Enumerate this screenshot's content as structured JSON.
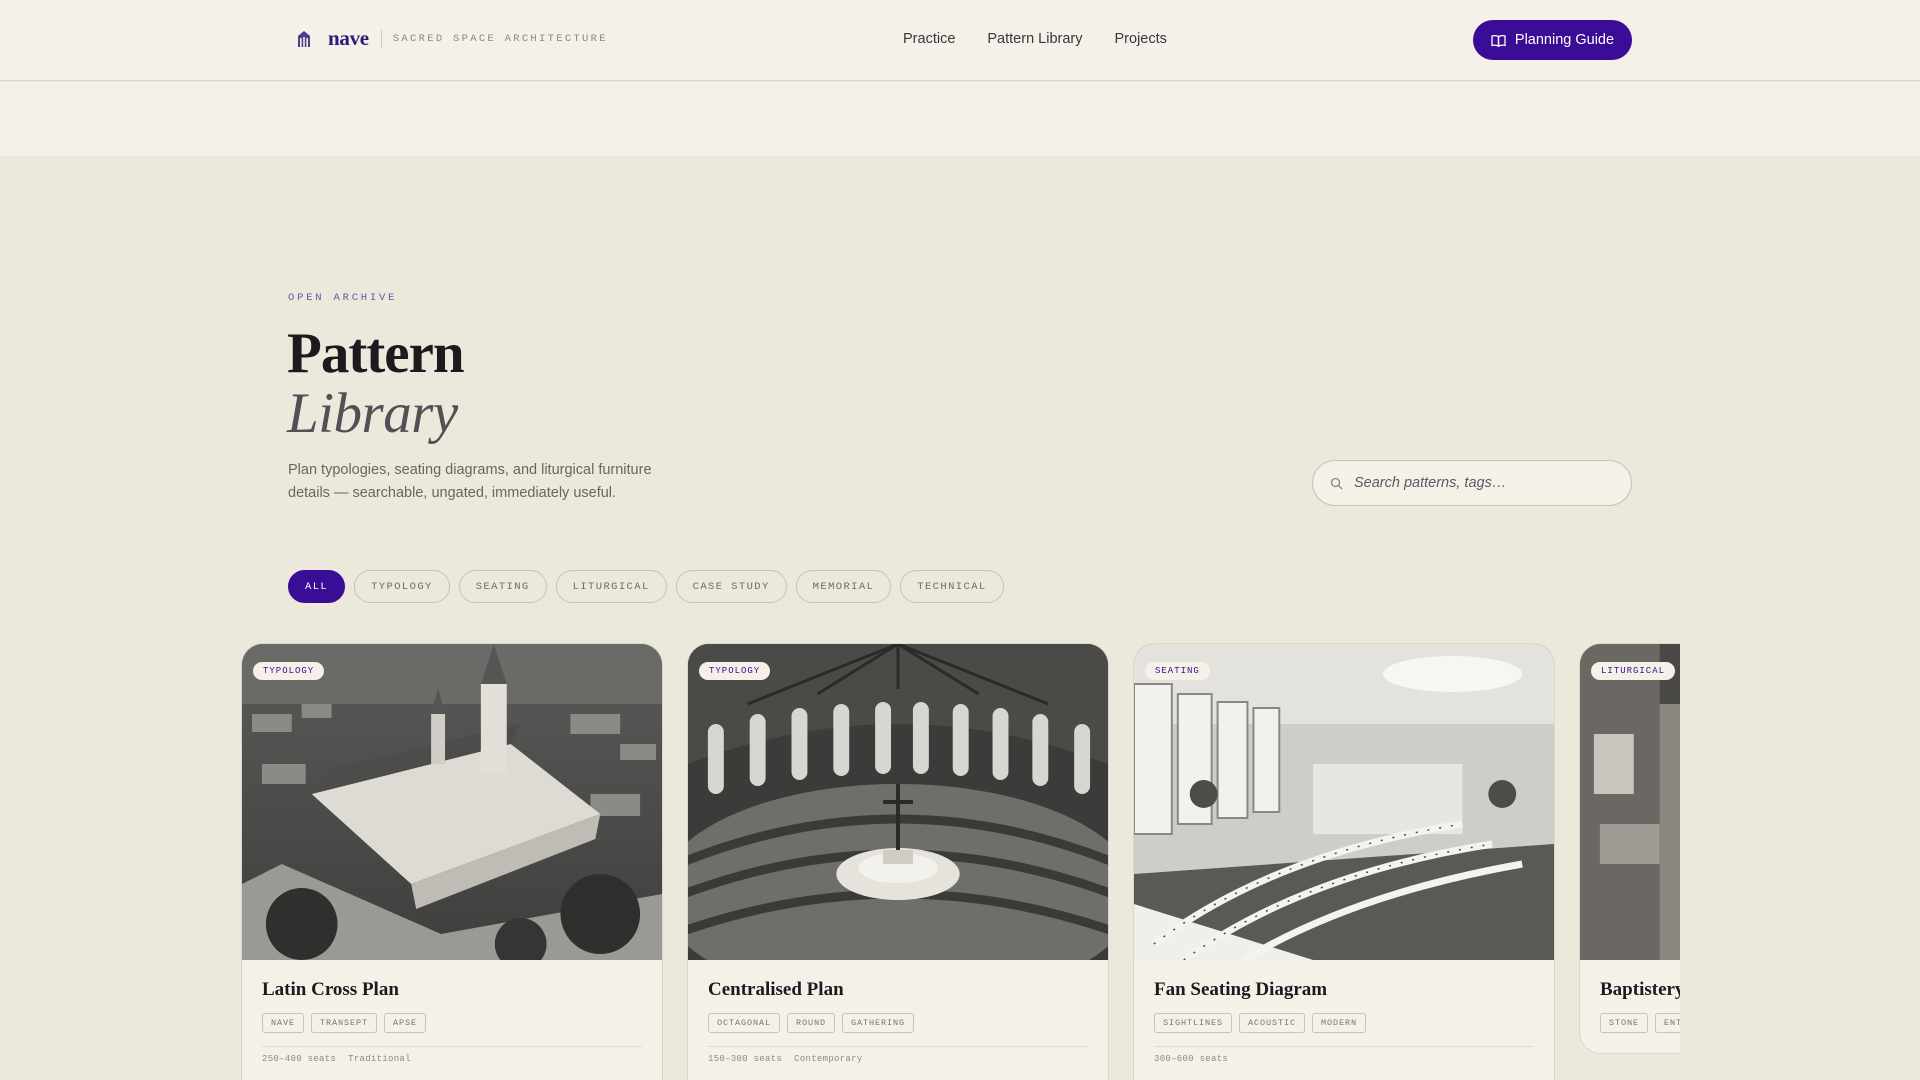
{
  "header": {
    "brand": {
      "name": "nave",
      "tagline": "SACRED SPACE ARCHITECTURE",
      "icon": "church-icon"
    },
    "nav": [
      "Practice",
      "Pattern Library",
      "Projects"
    ],
    "cta": {
      "label": "Planning Guide",
      "icon": "book-open-icon"
    }
  },
  "hero": {
    "eyebrow": "OPEN ARCHIVE",
    "title_line1": "Pattern",
    "title_line2": "Library",
    "subtitle": "Plan typologies, seating diagrams, and liturgical furniture details — searchable, ungated, immediately useful."
  },
  "search": {
    "placeholder": "Search patterns, tags…",
    "icon": "search-icon"
  },
  "filters": {
    "active": "ALL",
    "items": [
      "ALL",
      "TYPOLOGY",
      "SEATING",
      "LITURGICAL",
      "CASE STUDY",
      "MEMORIAL",
      "TECHNICAL"
    ]
  },
  "cards": [
    {
      "badge": "TYPOLOGY",
      "title": "Latin Cross Plan",
      "tags": [
        "NAVE",
        "TRANSEPT",
        "APSE"
      ],
      "meta": [
        "250–400 seats",
        "Traditional"
      ],
      "image": "aerial view of a cross-plan church"
    },
    {
      "badge": "TYPOLOGY",
      "title": "Centralised Plan",
      "tags": [
        "OCTAGONAL",
        "ROUND",
        "GATHERING"
      ],
      "meta": [
        "150–300 seats",
        "Contemporary"
      ],
      "image": "round worship hall interior with central altar"
    },
    {
      "badge": "SEATING",
      "title": "Fan Seating Diagram",
      "tags": [
        "SIGHTLINES",
        "ACOUSTIC",
        "MODERN"
      ],
      "meta": [
        "300–600 seats"
      ],
      "image": "modern hall with curved rows of chairs"
    },
    {
      "badge": "LITURGICAL",
      "title": "Baptistery",
      "tags": [
        "STONE",
        "ENT"
      ],
      "meta": [],
      "image": "stone baptistery interior"
    }
  ],
  "colors": {
    "accent": "#3a0d96",
    "background": "#ede8dc",
    "surface": "#f5f1e9"
  }
}
